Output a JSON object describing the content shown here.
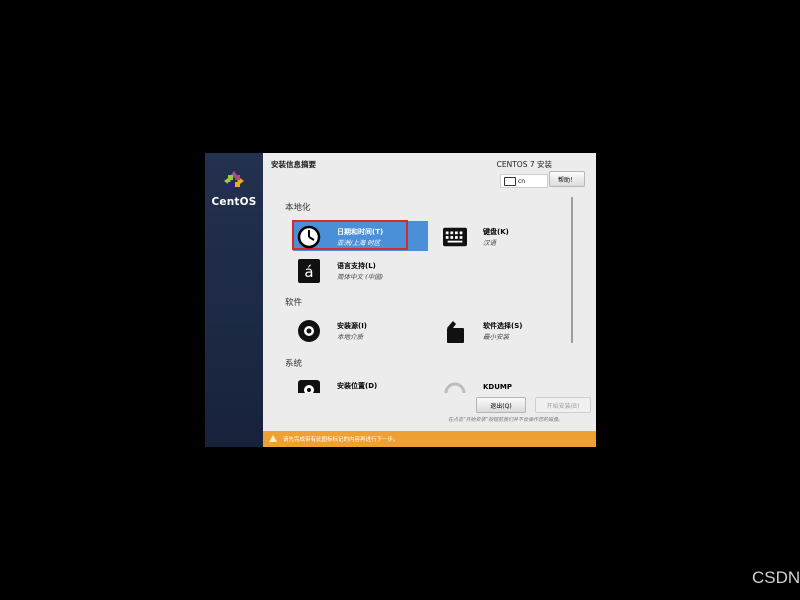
{
  "header": {
    "title": "安装信息摘要",
    "product": "CENTOS 7 安装"
  },
  "keyboard_indicator": {
    "label": "cn"
  },
  "help_button": {
    "label": "帮助！"
  },
  "sidebar": {
    "logo_text": "CentOS"
  },
  "sections": [
    {
      "label": "本地化"
    },
    {
      "label": "软件"
    },
    {
      "label": "系统"
    }
  ],
  "spokes": {
    "datetime": {
      "title": "日期和时间(T)",
      "subtitle": "亚洲/上海 时区",
      "icon": "clock-icon"
    },
    "keyboard": {
      "title": "键盘(K)",
      "subtitle": "汉语",
      "icon": "keyboard-icon"
    },
    "language": {
      "title": "语言支持(L)",
      "subtitle": "简体中文 (中国)",
      "icon": "language-icon"
    },
    "source": {
      "title": "安装源(I)",
      "subtitle": "本地介质",
      "icon": "disc-icon"
    },
    "software": {
      "title": "软件选择(S)",
      "subtitle": "最小安装",
      "icon": "package-icon"
    },
    "destination": {
      "title": "安装位置(D)",
      "subtitle": "",
      "icon": "harddisk-icon"
    },
    "kdump": {
      "title": "KDUMP",
      "subtitle": "",
      "icon": "kdump-icon"
    }
  },
  "buttons": {
    "quit": "退出(Q)",
    "begin": "开始安装(B)"
  },
  "notice": "在点击“开始安装”按钮前我们并不会操作您的磁盘。",
  "warning": "请先完成带有此图标标记的内容再进行下一步。",
  "watermark": "CSDN",
  "colors": {
    "selection": "#4a90d9",
    "warning_bar": "#f0a030",
    "sidebar": "#1d2a45",
    "highlight_box": "#d92a2a"
  }
}
